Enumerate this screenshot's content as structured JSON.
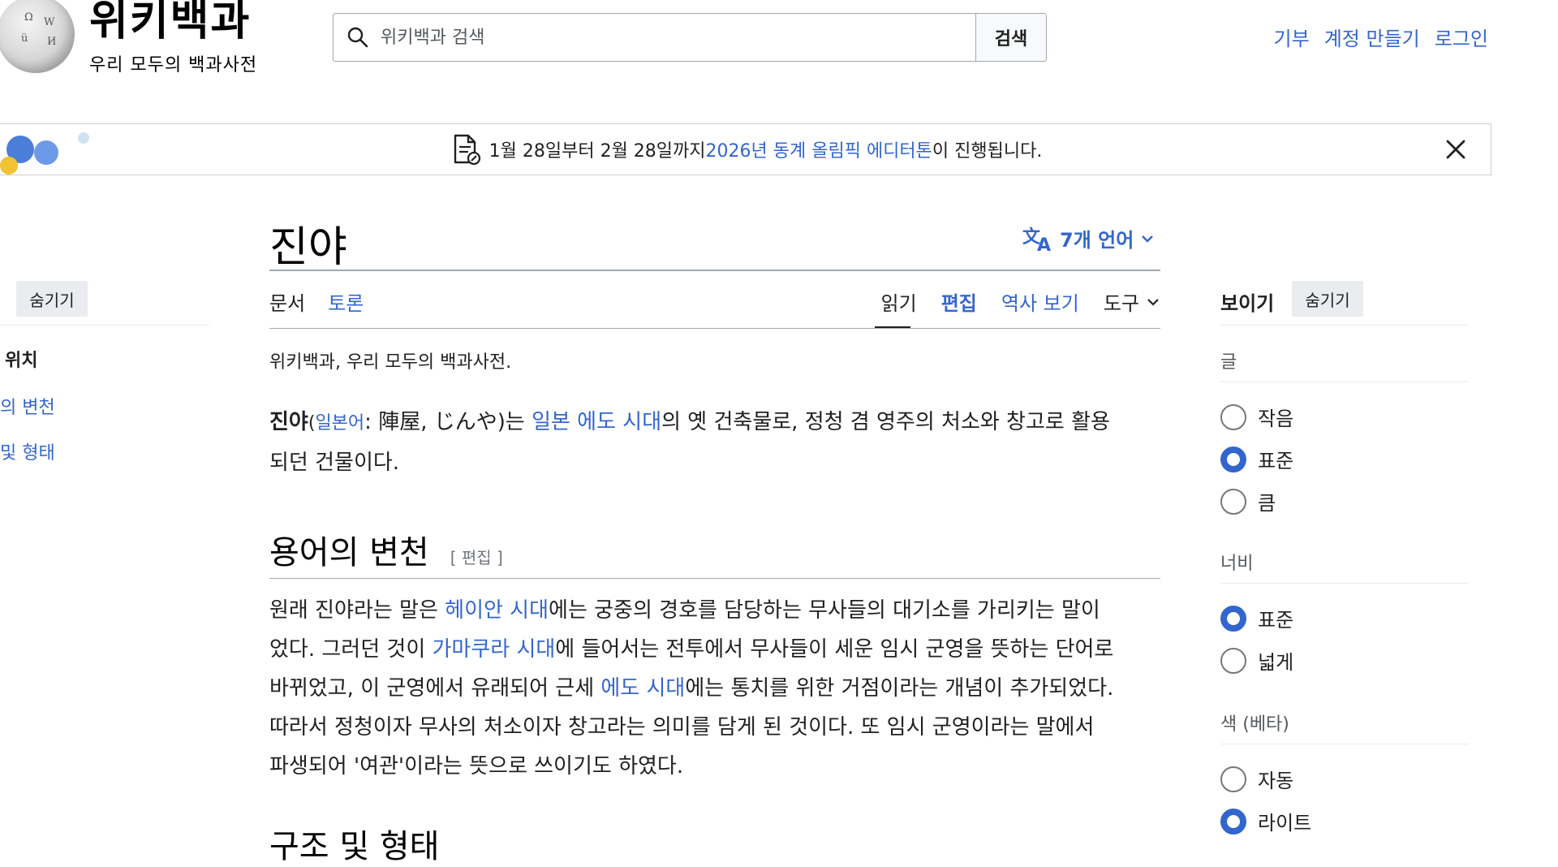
{
  "header": {
    "wordmark": "위키백과",
    "tagline": "우리 모두의 백과사전",
    "search_placeholder": "위키백과 검색",
    "search_button": "검색",
    "top_links": [
      "기부",
      "계정 만들기",
      "로그인"
    ]
  },
  "banner": {
    "text_before": "1월 28일부터 2월 28일까지 ",
    "link_text": "2026년 동계 올림픽 에디터톤",
    "text_after": "이 진행됩니다."
  },
  "left_sidebar": {
    "hide_label": "숨기기",
    "toc_heading": "위치",
    "toc_items": [
      "의 변천",
      "및 형태"
    ]
  },
  "article": {
    "title": "진야",
    "languages_label": "7개 언어",
    "tabs_left": [
      "문서",
      "토론"
    ],
    "tabs_right": [
      "읽기",
      "편집",
      "역사 보기",
      "도구"
    ],
    "from_line": "위키백과, 우리 모두의 백과사전.",
    "lead": {
      "bold": "진야",
      "paren_open": "(",
      "lang_link": "일본어",
      "lang_rest": ": 陣屋, じんや)는 ",
      "link1": "일본",
      "sp": " ",
      "link2": "에도 시대",
      "rest_line1": "의 옛 건축물로, 정청 겸 영주의 처소와 창고로 활용",
      "rest_line2": "되던 건물이다."
    },
    "section1": {
      "heading": "용어의 변천",
      "edit_label": "[ 편집 ]",
      "p1": "원래 진야라는 말은 ",
      "l1": "헤이안 시대",
      "p2": "에는 궁중의 경호를 담당하는 무사들의 대기소를 가리키는 말이",
      "p3": "었다. 그러던 것이 ",
      "l2": "가마쿠라 시대",
      "p4": "에 들어서는 전투에서 무사들이 세운 임시 군영을 뜻하는 단어로",
      "p5": "바뀌었고, 이 군영에서 유래되어 근세 ",
      "l3": "에도 시대",
      "p6": "에는 통치를 위한 거점이라는 개념이 추가되었다.",
      "p7": "따라서 정청이자 무사의 처소이자 창고라는 의미를 담게 된 것이다. 또 임시 군영이라는 말에서",
      "p8": "파생되어 '여관'이라는 뜻으로 쓰이기도 하였다."
    },
    "section2_heading_partial": "구조 및 형태"
  },
  "appearance": {
    "title": "보이기",
    "hide_label": "숨기기",
    "text_heading": "글",
    "text_options": [
      {
        "label": "작음",
        "selected": false
      },
      {
        "label": "표준",
        "selected": true
      },
      {
        "label": "큼",
        "selected": false
      }
    ],
    "width_heading": "너비",
    "width_options": [
      {
        "label": "표준",
        "selected": true
      },
      {
        "label": "넓게",
        "selected": false
      }
    ],
    "color_heading": "색 (베타)",
    "color_options": [
      {
        "label": "자동",
        "selected": false
      },
      {
        "label": "라이트",
        "selected": true
      }
    ]
  },
  "colors": {
    "link": "#3366cc",
    "text": "#202122",
    "radio_selected": "#3366cc"
  }
}
